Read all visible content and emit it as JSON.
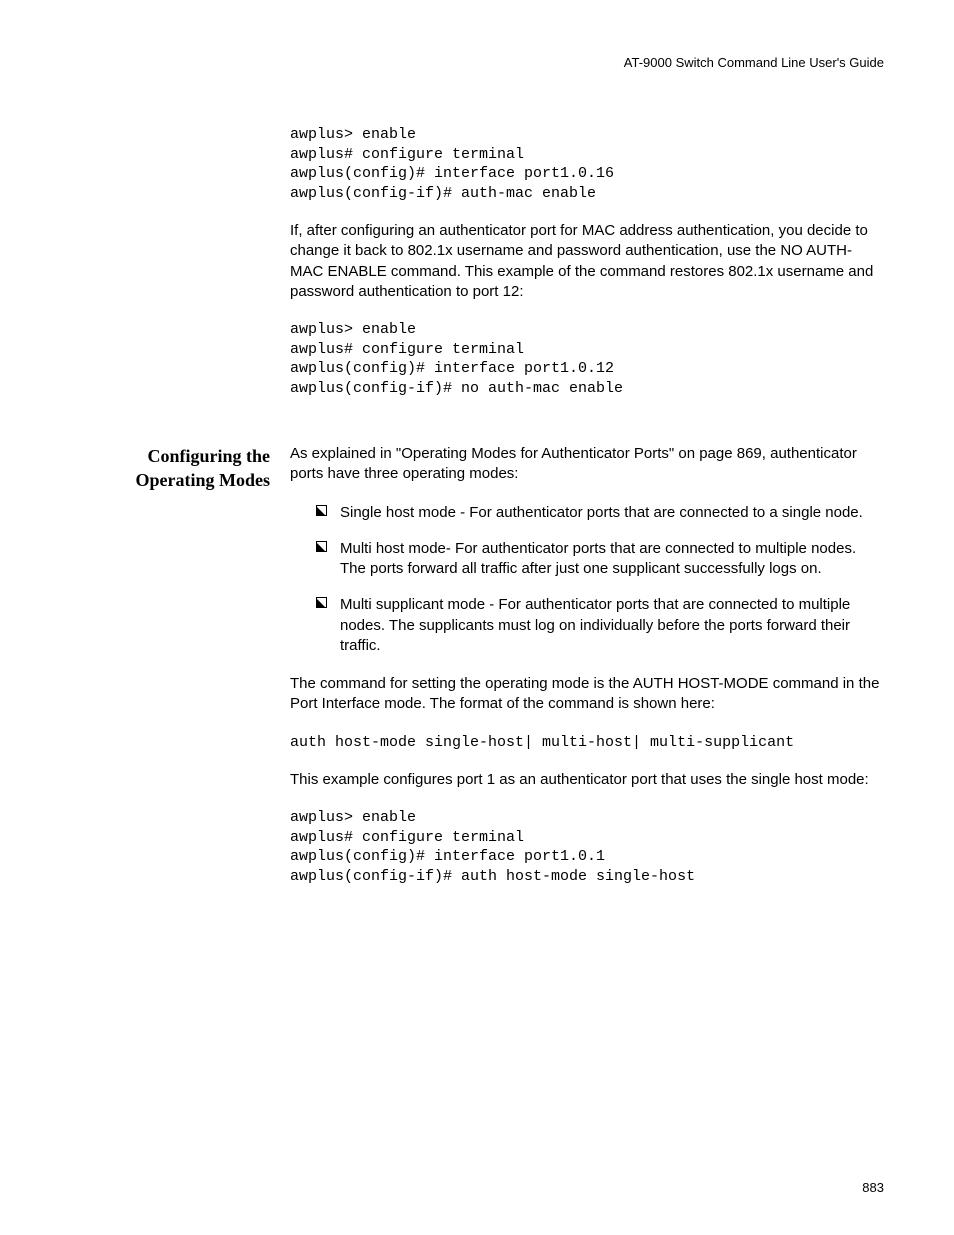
{
  "header": "AT-9000 Switch Command Line User's Guide",
  "code1": "awplus> enable\nawplus# configure terminal\nawplus(config)# interface port1.0.16\nawplus(config-if)# auth-mac enable",
  "para1": "If, after configuring an authenticator port for MAC address authentication, you decide to change it back to 802.1x username and password authentication, use the NO AUTH-MAC ENABLE command. This example of the command restores 802.1x username and password authentication to port 12:",
  "code2": "awplus> enable\nawplus# configure terminal\nawplus(config)# interface port1.0.12\nawplus(config-if)# no auth-mac enable",
  "section_heading": "Configuring the Operating Modes",
  "para2": "As explained in \"Operating Modes for Authenticator Ports\" on page 869, authenticator ports have three operating modes:",
  "bullets": [
    "Single host mode - For authenticator ports that are connected to a single node.",
    "Multi host mode- For authenticator ports that are connected to multiple nodes. The ports forward all traffic after just one supplicant successfully logs on.",
    "Multi supplicant mode - For authenticator ports that are connected to multiple nodes. The supplicants must log on individually before the ports forward their traffic."
  ],
  "para3": "The command for setting the operating mode is the AUTH HOST-MODE command in the Port Interface mode. The format of the command is shown here:",
  "code3": "auth host-mode single-host| multi-host| multi-supplicant",
  "para4": "This example configures port 1 as an authenticator port that uses the single host mode:",
  "code4": "awplus> enable\nawplus# configure terminal\nawplus(config)# interface port1.0.1\nawplus(config-if)# auth host-mode single-host",
  "pagenum": "883"
}
